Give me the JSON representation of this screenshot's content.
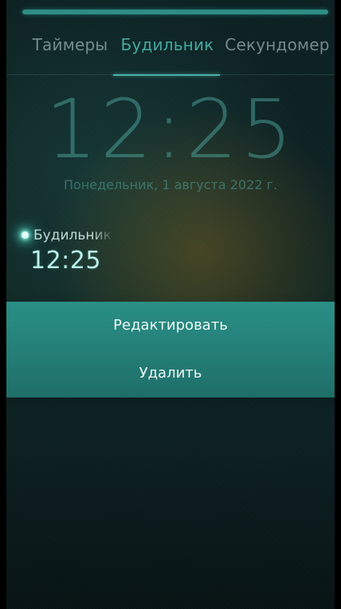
{
  "tabs": {
    "timers": "Таймеры",
    "alarm": "Будильник",
    "stopwatch": "Секундомер"
  },
  "clock": {
    "time": "12:25",
    "date": "Понедельник, 1 августа 2022 г."
  },
  "alarm_item": {
    "name": "Будильник",
    "time": "12:25"
  },
  "context_menu": {
    "edit": "Редактировать",
    "delete": "Удалить"
  },
  "colors": {
    "accent": "#45a99f",
    "menu_background": "#2a8f86",
    "background": "#0f2323"
  }
}
